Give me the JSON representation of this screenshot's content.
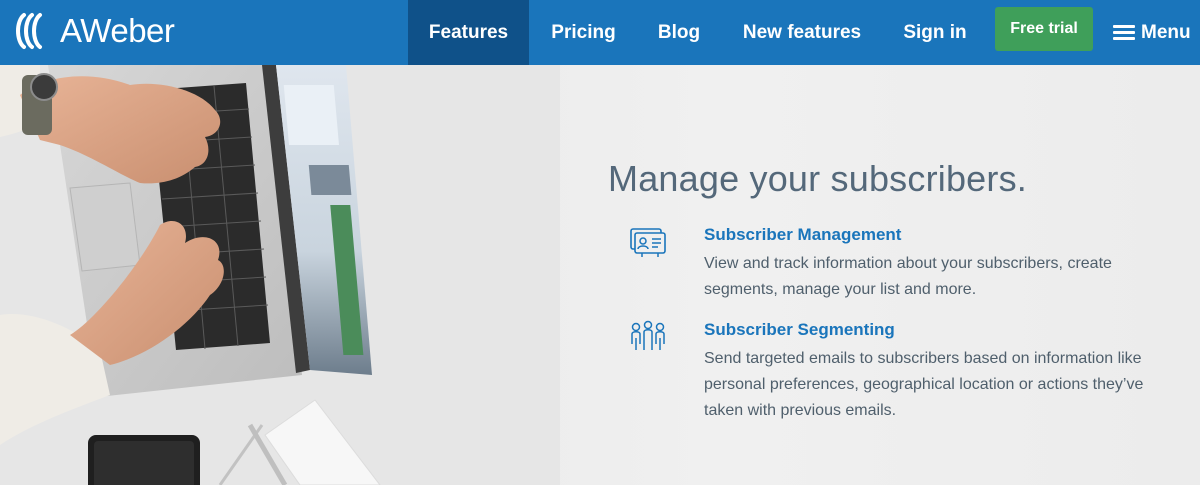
{
  "brand": {
    "name": "AWeber",
    "logo_icon": "aweber-waves-icon"
  },
  "nav": {
    "items": [
      {
        "label": "Features",
        "active": true
      },
      {
        "label": "Pricing",
        "active": false
      },
      {
        "label": "Blog",
        "active": false
      },
      {
        "label": "New features",
        "active": false
      },
      {
        "label": "Sign in",
        "active": false
      }
    ],
    "cta_label": "Free trial",
    "menu_label": "Menu"
  },
  "hero": {
    "headline": "Manage your subscribers.",
    "features": [
      {
        "icon": "subscriber-card-icon",
        "title": "Subscriber Management",
        "description": "View and track information about your subscribers, create segments, manage your list and more."
      },
      {
        "icon": "people-group-icon",
        "title": "Subscriber Segmenting",
        "description": "Send targeted emails to subscribers based on information like personal preferences, geographical location or actions they’ve taken with previous emails."
      }
    ]
  },
  "colors": {
    "nav_bg": "#1a75bb",
    "nav_active": "#0f5189",
    "cta": "#3f9f5a",
    "headline": "#54687a",
    "feature_title": "#1a75bb"
  }
}
